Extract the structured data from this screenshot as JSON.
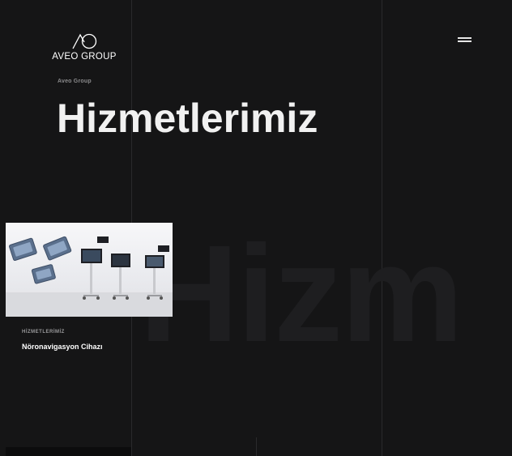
{
  "brand": {
    "logo_text": "AVEO GROUP"
  },
  "header": {
    "menu_icon": "hamburger-menu-icon"
  },
  "breadcrumb": {
    "label": "Aveo Group"
  },
  "page": {
    "title": "Hizmetlerimiz",
    "background_word": "Hizm"
  },
  "services": [
    {
      "category": "HİZMETLERİMİZ",
      "title": "Nöronavigasyon Cihazı"
    }
  ],
  "colors": {
    "background": "#151516",
    "divider": "#2a2a2c",
    "text_primary": "#ffffff",
    "text_muted": "#8a8a8c"
  }
}
